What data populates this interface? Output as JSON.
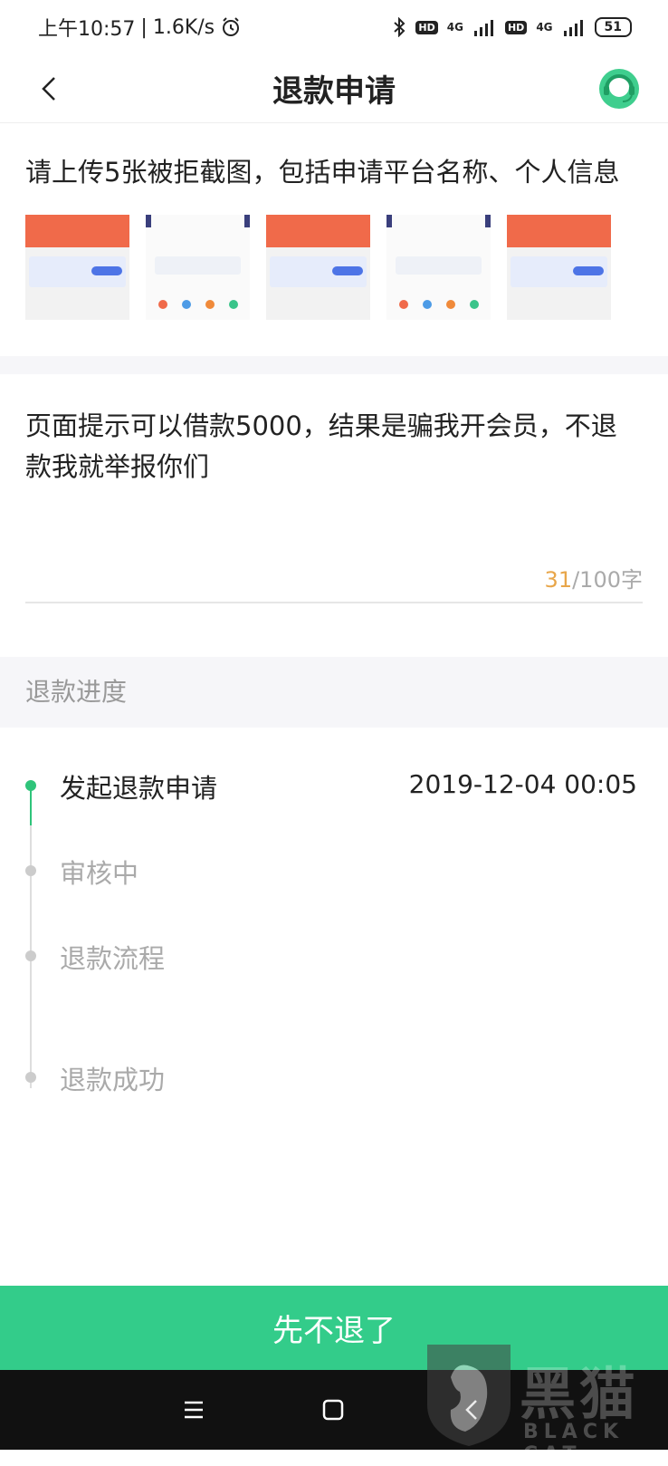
{
  "status_bar": {
    "time": "上午10:57",
    "speed": "1.6K/s",
    "hd1": "HD",
    "net1": "4G",
    "hd2": "HD",
    "net2": "4G",
    "battery": "51"
  },
  "header": {
    "title": "退款申请"
  },
  "upload": {
    "title": "请上传5张被拒截图，包括申请平台名称、个人信息"
  },
  "description": {
    "text": "页面提示可以借款5000，结果是骗我开会员，不退款我就举报你们",
    "count": "31",
    "max": "/100字"
  },
  "progress": {
    "header": "退款进度",
    "steps": [
      {
        "label": "发起退款申请",
        "time": "2019-12-04 00:05",
        "active": true
      },
      {
        "label": "审核中",
        "time": "",
        "active": false
      },
      {
        "label": "退款流程",
        "time": "",
        "active": false
      },
      {
        "label": "退款成功",
        "time": "",
        "active": false
      }
    ]
  },
  "footer": {
    "cancel_label": "先不退了"
  },
  "watermark": {
    "text": "黑猫",
    "sub": "BLACK CAT"
  },
  "colors": {
    "accent": "#33cc8a",
    "timeline_active": "#2fc47a",
    "counter_current": "#e8a64a"
  },
  "icons": {
    "back": "chevron-left-icon",
    "service": "customer-service-icon",
    "nav_menu": "menu-icon",
    "nav_home": "square-icon",
    "nav_back": "back-triangle-icon"
  }
}
